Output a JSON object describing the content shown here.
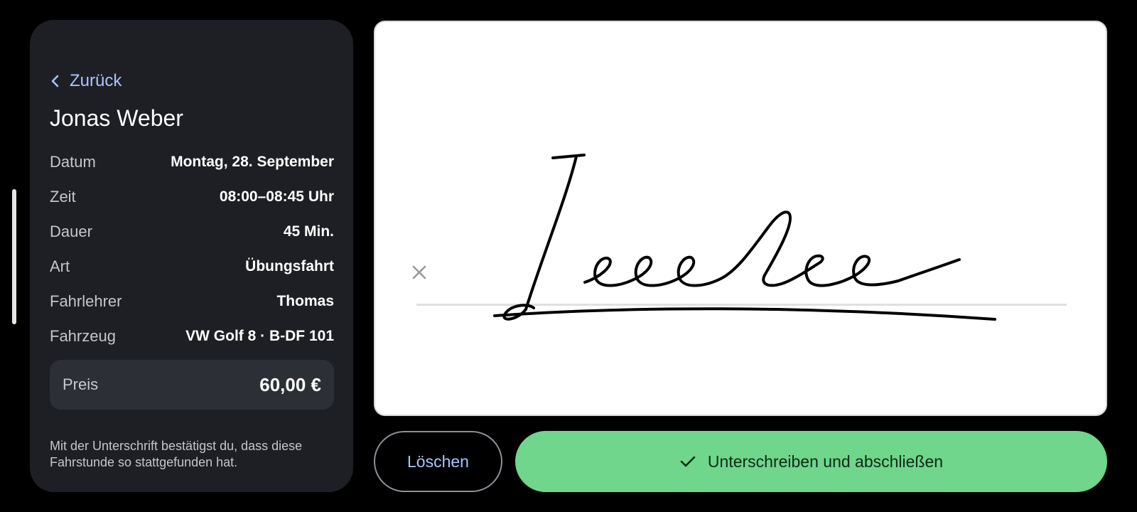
{
  "back": {
    "label": "Zurück"
  },
  "student": {
    "name": "Jonas Weber"
  },
  "details": [
    {
      "label": "Datum",
      "value": "Montag, 28. September"
    },
    {
      "label": "Zeit",
      "value": "08:00–08:45 Uhr"
    },
    {
      "label": "Dauer",
      "value": "45 Min."
    },
    {
      "label": "Art",
      "value": "Übungsfahrt"
    },
    {
      "label": "Fahrlehrer",
      "value": "Thomas"
    },
    {
      "label": "Fahrzeug",
      "value": "VW Golf 8 · B-DF 101"
    }
  ],
  "price": {
    "label": "Preis",
    "value": "60,00 €"
  },
  "disclaimer": "Mit der Unterschrift bestätigst du, dass diese Fahrstunde so stattgefunden hat.",
  "actions": {
    "clear_label": "Löschen",
    "sign_label": "Unterschreiben und abschließen"
  },
  "icons": {
    "back": "chevron-left-icon",
    "clear_signature": "close-icon",
    "confirm": "check-icon"
  },
  "colors": {
    "background": "#000000",
    "panel": "#1e1f24",
    "accent_link": "#a6c6ff",
    "primary_button": "#6fd68b",
    "price_box": "#2d2f36"
  }
}
